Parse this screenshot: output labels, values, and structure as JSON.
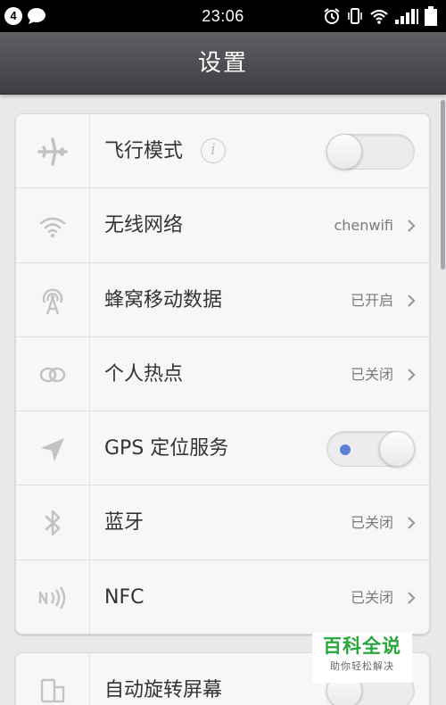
{
  "status_bar": {
    "notification_count": "4",
    "time": "23:06"
  },
  "header": {
    "title": "设置"
  },
  "settings": {
    "items": [
      {
        "label": "飞行模式",
        "icon": "airplane-icon",
        "control": "toggle",
        "toggle_on": false
      },
      {
        "label": "无线网络",
        "icon": "wifi-icon",
        "value": "chenwifi"
      },
      {
        "label": "蜂窝移动数据",
        "icon": "cellular-antenna-icon",
        "value": "已开启"
      },
      {
        "label": "个人热点",
        "icon": "hotspot-link-icon",
        "value": "已关闭"
      },
      {
        "label": "GPS 定位服务",
        "icon": "location-arrow-icon",
        "control": "toggle",
        "toggle_on": true
      },
      {
        "label": "蓝牙",
        "icon": "bluetooth-icon",
        "value": "已关闭"
      },
      {
        "label": "NFC",
        "icon": "nfc-icon",
        "value": "已关闭"
      }
    ],
    "group2": [
      {
        "label": "自动旋转屏幕",
        "icon": "auto-rotate-icon",
        "control": "toggle",
        "toggle_on": false
      }
    ]
  },
  "watermark": {
    "title": "百科全说",
    "subtitle": "助你轻松解决"
  },
  "colors": {
    "toggle_on_dot": "#5e7fd8",
    "watermark_green": "#2aa63e"
  }
}
